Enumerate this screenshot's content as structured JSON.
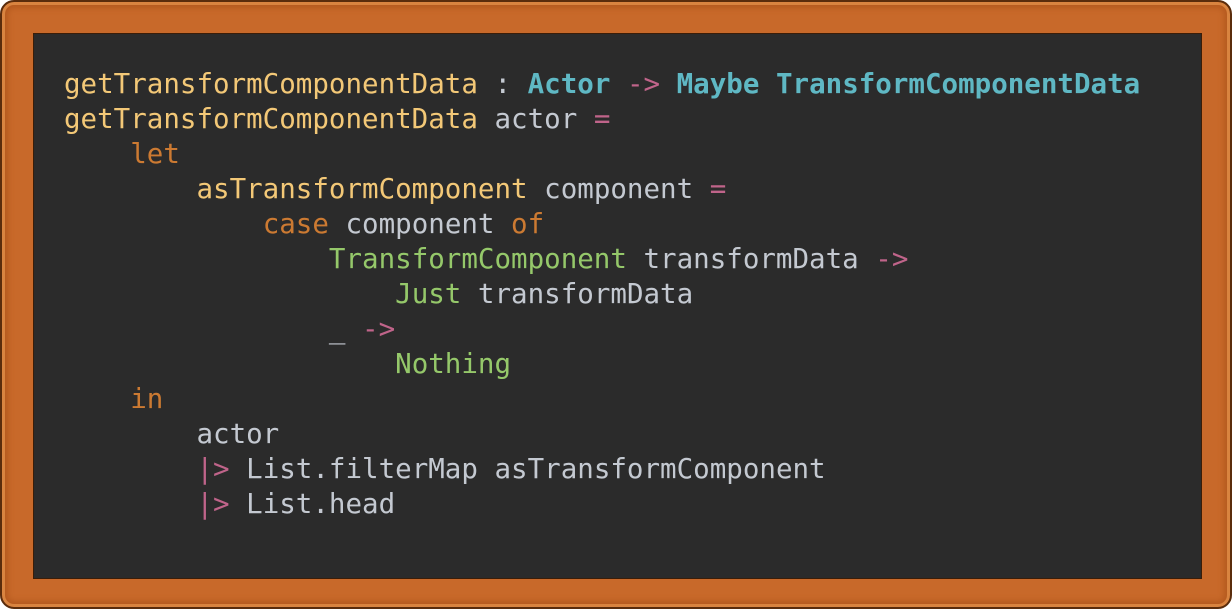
{
  "code": {
    "lines": [
      [
        {
          "t": "getTransformComponentData",
          "c": "fn"
        },
        {
          "t": " : ",
          "c": "txt"
        },
        {
          "t": "Actor",
          "c": "typ"
        },
        {
          "t": " -> ",
          "c": "op"
        },
        {
          "t": "Maybe TransformComponentData",
          "c": "typ"
        }
      ],
      [
        {
          "t": "getTransformComponentData",
          "c": "fn"
        },
        {
          "t": " actor ",
          "c": "txt"
        },
        {
          "t": "=",
          "c": "op"
        }
      ],
      [
        {
          "t": "    ",
          "c": "txt"
        },
        {
          "t": "let",
          "c": "kw"
        }
      ],
      [
        {
          "t": "        ",
          "c": "txt"
        },
        {
          "t": "asTransformComponent",
          "c": "fn"
        },
        {
          "t": " component ",
          "c": "txt"
        },
        {
          "t": "=",
          "c": "op"
        }
      ],
      [
        {
          "t": "            ",
          "c": "txt"
        },
        {
          "t": "case",
          "c": "kw"
        },
        {
          "t": " component ",
          "c": "txt"
        },
        {
          "t": "of",
          "c": "kw"
        }
      ],
      [
        {
          "t": "                ",
          "c": "txt"
        },
        {
          "t": "TransformComponent",
          "c": "ctor"
        },
        {
          "t": " transformData ",
          "c": "txt"
        },
        {
          "t": "->",
          "c": "op"
        }
      ],
      [
        {
          "t": "                    ",
          "c": "txt"
        },
        {
          "t": "Just",
          "c": "ctor"
        },
        {
          "t": " transformData",
          "c": "txt"
        }
      ],
      [
        {
          "t": "                ",
          "c": "txt"
        },
        {
          "t": "_",
          "c": "txt"
        },
        {
          "t": " ->",
          "c": "op"
        }
      ],
      [
        {
          "t": "                    ",
          "c": "txt"
        },
        {
          "t": "Nothing",
          "c": "ctor"
        }
      ],
      [
        {
          "t": "    ",
          "c": "txt"
        },
        {
          "t": "in",
          "c": "kw"
        }
      ],
      [
        {
          "t": "        ",
          "c": "txt"
        },
        {
          "t": "actor",
          "c": "txt"
        }
      ],
      [
        {
          "t": "        ",
          "c": "txt"
        },
        {
          "t": "|>",
          "c": "op"
        },
        {
          "t": " List.filterMap asTransformComponent",
          "c": "txt"
        }
      ],
      [
        {
          "t": "        ",
          "c": "txt"
        },
        {
          "t": "|>",
          "c": "op"
        },
        {
          "t": " List.head",
          "c": "txt"
        }
      ]
    ]
  },
  "colors": {
    "frame": "#c8692a",
    "panel_background": "#2b2b2b",
    "function_name": "#f3c877",
    "type_name": "#5fb8c4",
    "operator": "#c0648a",
    "keyword": "#cc7a32",
    "constructor": "#95c86a",
    "plain_text": "#c4c9d1"
  }
}
